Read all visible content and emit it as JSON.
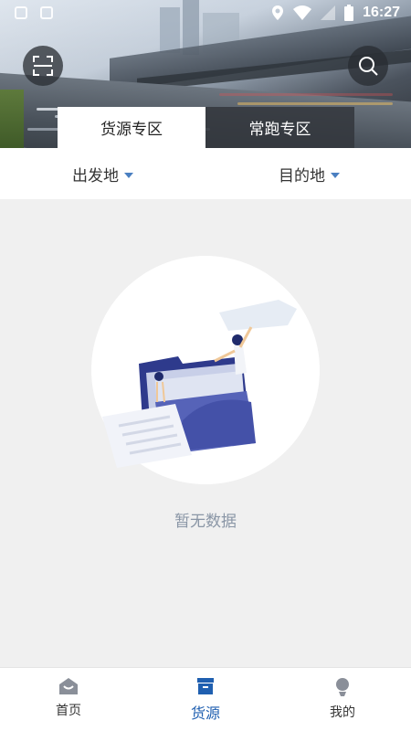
{
  "status_bar": {
    "time": "16:27"
  },
  "tabs": [
    {
      "label": "货源专区",
      "active": true
    },
    {
      "label": "常跑专区",
      "active": false
    }
  ],
  "filters": {
    "origin": "出发地",
    "destination": "目的地"
  },
  "empty_state": {
    "message": "暂无数据"
  },
  "bottom_nav": [
    {
      "label": "首页",
      "icon": "home-icon",
      "active": false
    },
    {
      "label": "货源",
      "icon": "cargo-box-icon",
      "active": true
    },
    {
      "label": "我的",
      "icon": "person-icon",
      "active": false
    }
  ],
  "colors": {
    "accent": "#1f5fb0",
    "caret": "#4a7fc1",
    "empty_text": "#8a96a6"
  }
}
